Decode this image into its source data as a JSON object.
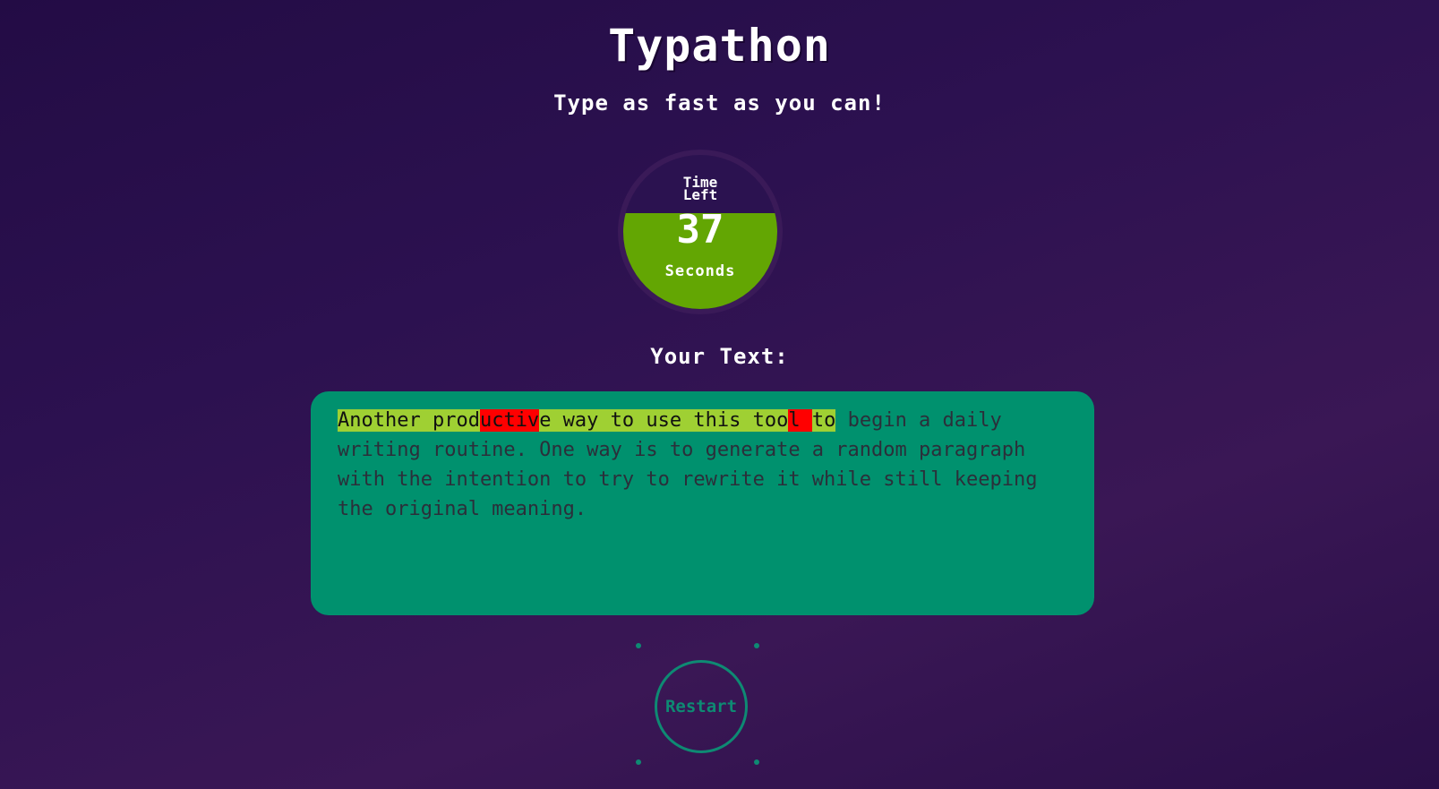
{
  "app": {
    "title": "Typathon",
    "subtitle": "Type as fast as you can!"
  },
  "timer": {
    "label": "Time Left",
    "value": "37",
    "unit": "Seconds",
    "remaining_fraction": 0.62,
    "fill_color": "#63a603"
  },
  "passage": {
    "heading": "Your Text:",
    "segments": [
      {
        "text": "Another prod",
        "state": "correct"
      },
      {
        "text": "uctiv",
        "state": "error"
      },
      {
        "text": "e way to use this too",
        "state": "correct"
      },
      {
        "text": "l ",
        "state": "error"
      },
      {
        "text": "to",
        "state": "correct"
      },
      {
        "text": " begin a daily writing routine. One way is to generate a random paragraph with the intention to try to rewrite it while still keeping the original meaning.",
        "state": "pending"
      }
    ],
    "colors": {
      "box": "#00916e",
      "correct": "#9fd033",
      "error": "#ff0000"
    }
  },
  "controls": {
    "restart_label": "Restart",
    "accent": "#0e8a73"
  }
}
